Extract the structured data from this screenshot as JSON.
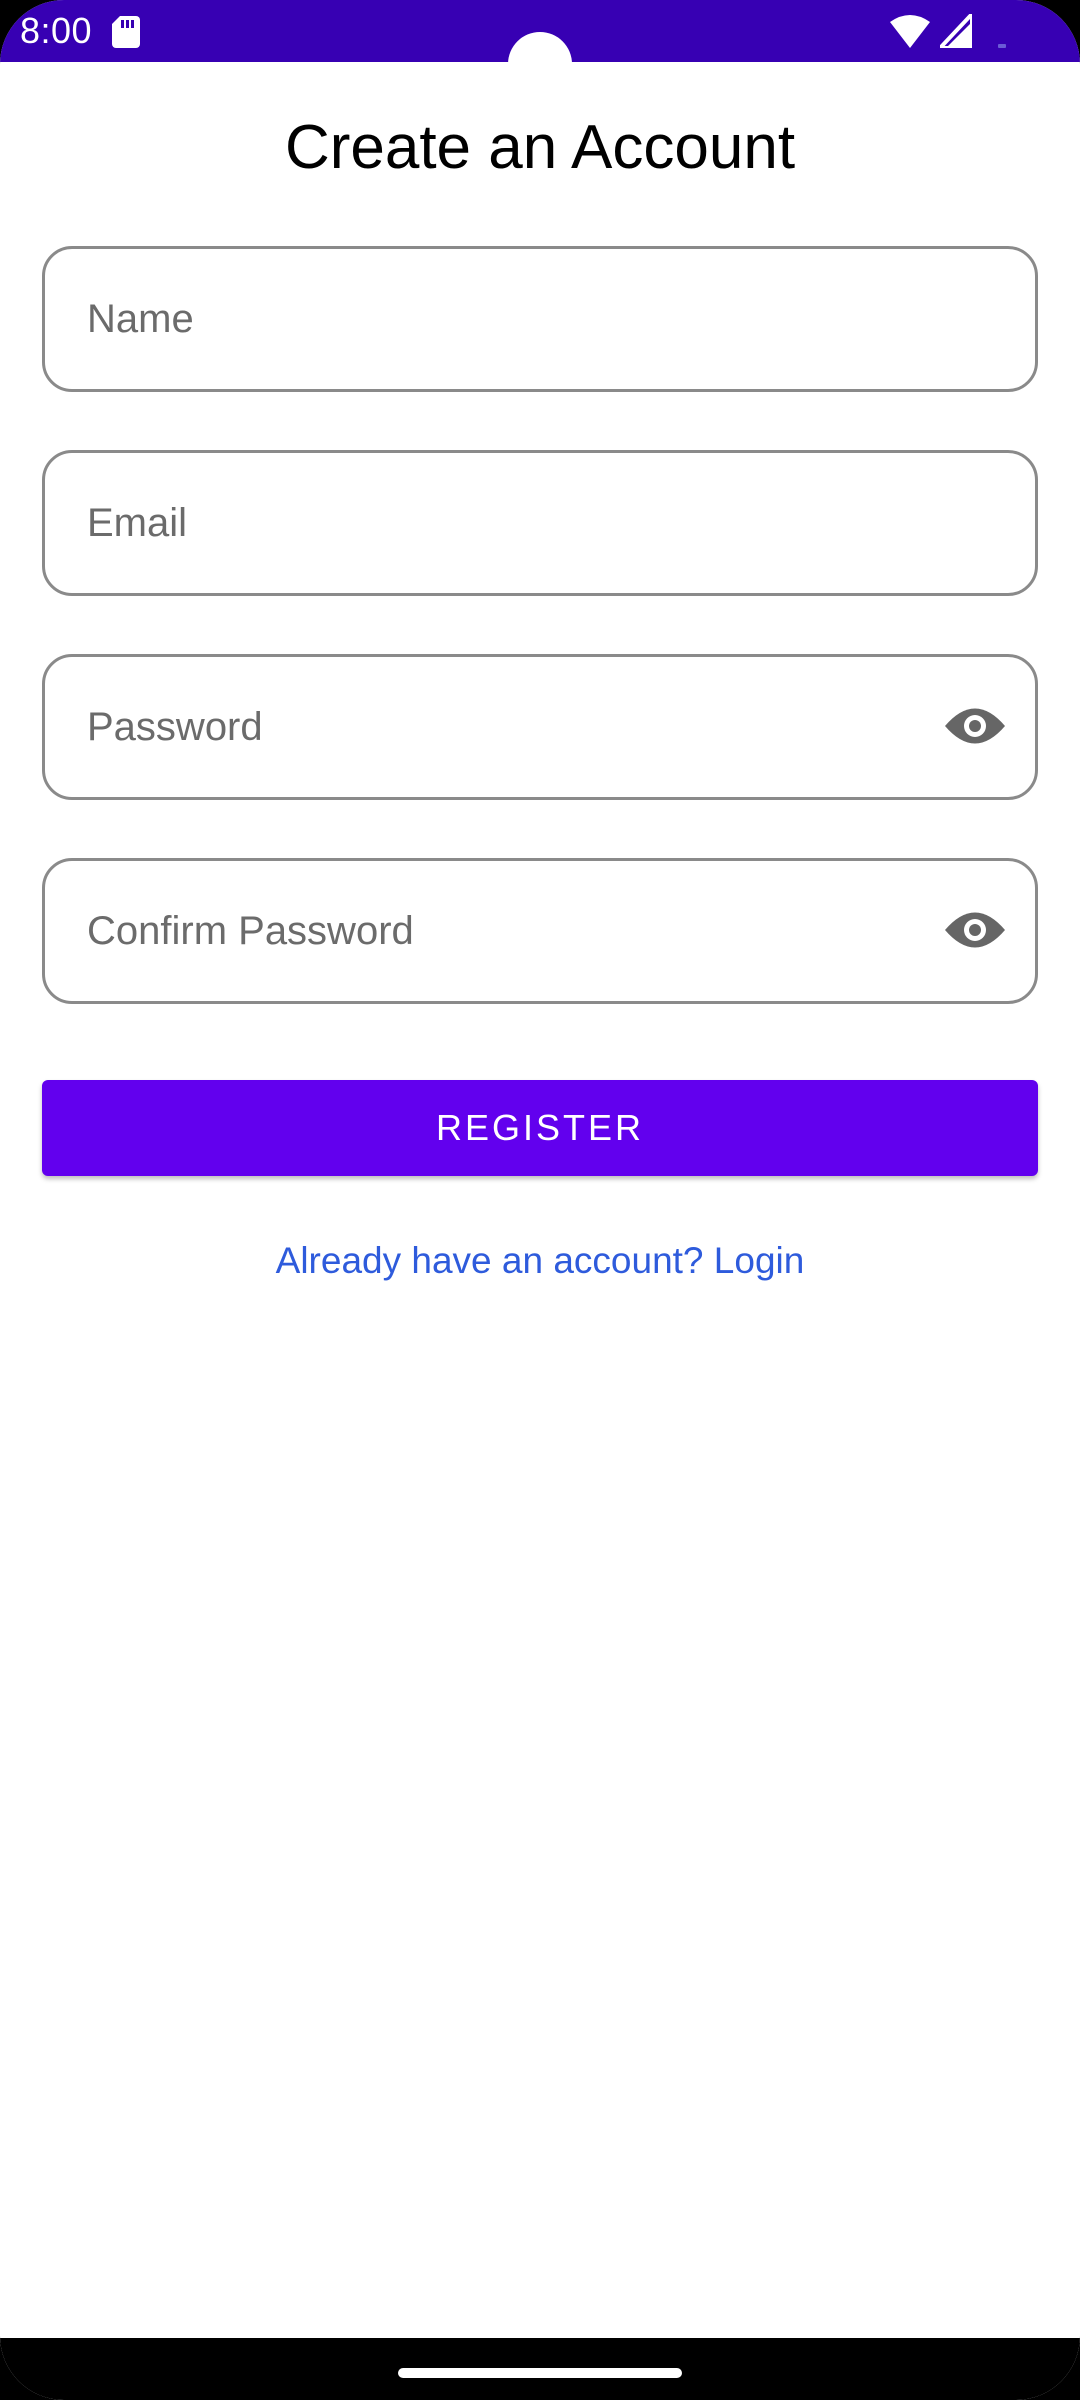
{
  "status_bar": {
    "time": "8:00",
    "icons": [
      "sd-card-icon",
      "wifi-icon",
      "signal-icon",
      "battery-icon"
    ]
  },
  "page": {
    "title": "Create an Account"
  },
  "form": {
    "name_placeholder": "Name",
    "email_placeholder": "Email",
    "password_placeholder": "Password",
    "confirm_password_placeholder": "Confirm Password",
    "password_toggle_icon": "eye-icon",
    "register_label": "REGISTER",
    "login_link_label": "Already have an account? Login"
  },
  "colors": {
    "status_bar": "#3700b3",
    "primary": "#6200ee",
    "link": "#2e5bdc",
    "field_border": "#8a8a8a",
    "placeholder": "#6b6b6b"
  }
}
